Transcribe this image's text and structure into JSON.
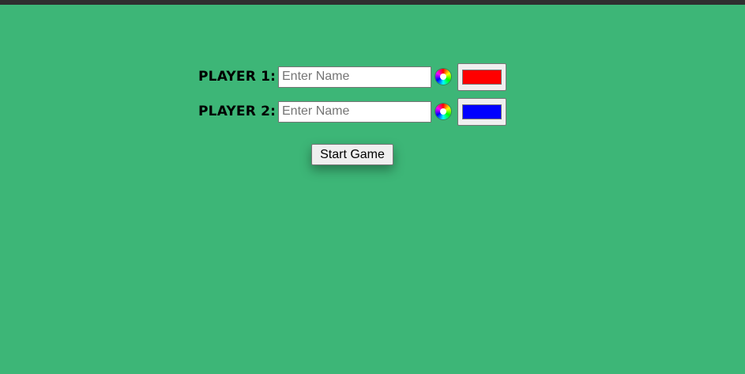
{
  "players": [
    {
      "label": "PLAYER 1:",
      "name_value": "",
      "name_placeholder": "Enter Name",
      "color": "#ff0000",
      "color_icon": "color-wheel-icon"
    },
    {
      "label": "PLAYER 2:",
      "name_value": "",
      "name_placeholder": "Enter Name",
      "color": "#0000ff",
      "color_icon": "color-wheel-icon"
    }
  ],
  "start_button_label": "Start Game",
  "colors": {
    "background": "#3db677",
    "topbar": "#2f2f2f"
  }
}
